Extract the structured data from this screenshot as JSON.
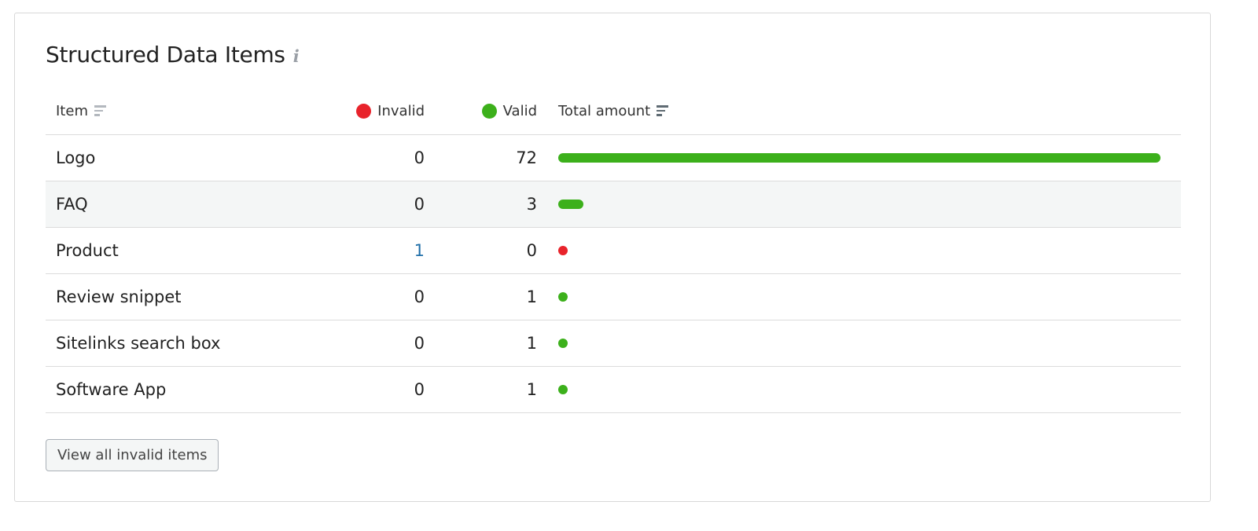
{
  "widget": {
    "title": "Structured Data Items",
    "info_icon": "i",
    "button_label": "View all invalid items"
  },
  "colors": {
    "invalid": "#e8232b",
    "valid": "#3cb01b"
  },
  "icons": {
    "info": "info-icon",
    "sort": "sort-icon",
    "invalid_legend": "red-dot-icon",
    "valid_legend": "green-dot-icon"
  },
  "table": {
    "headers": {
      "item": "Item",
      "invalid": "Invalid",
      "valid": "Valid",
      "total": "Total amount"
    },
    "rows": [
      {
        "item": "Logo",
        "invalid": "0",
        "valid": "72"
      },
      {
        "item": "FAQ",
        "invalid": "0",
        "valid": "3"
      },
      {
        "item": "Product",
        "invalid": "1",
        "valid": "0"
      },
      {
        "item": "Review snippet",
        "invalid": "0",
        "valid": "1"
      },
      {
        "item": "Sitelinks search box",
        "invalid": "0",
        "valid": "1"
      },
      {
        "item": "Software App",
        "invalid": "0",
        "valid": "1"
      }
    ]
  }
}
